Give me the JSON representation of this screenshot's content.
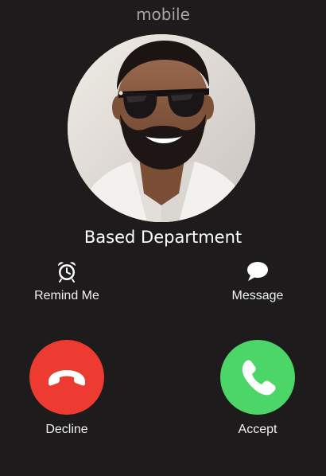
{
  "call": {
    "type_label": "mobile",
    "caller_name": "Based Department"
  },
  "options": {
    "remind_label": "Remind Me",
    "remind_icon": "alarm-clock-icon",
    "message_label": "Message",
    "message_icon": "speech-bubble-icon"
  },
  "actions": {
    "decline_label": "Decline",
    "decline_icon": "hang-up-phone-icon",
    "decline_color": "#ed3b32",
    "accept_label": "Accept",
    "accept_icon": "phone-icon",
    "accept_color": "#4bd667"
  },
  "theme": {
    "background": "#1d1b1c"
  }
}
